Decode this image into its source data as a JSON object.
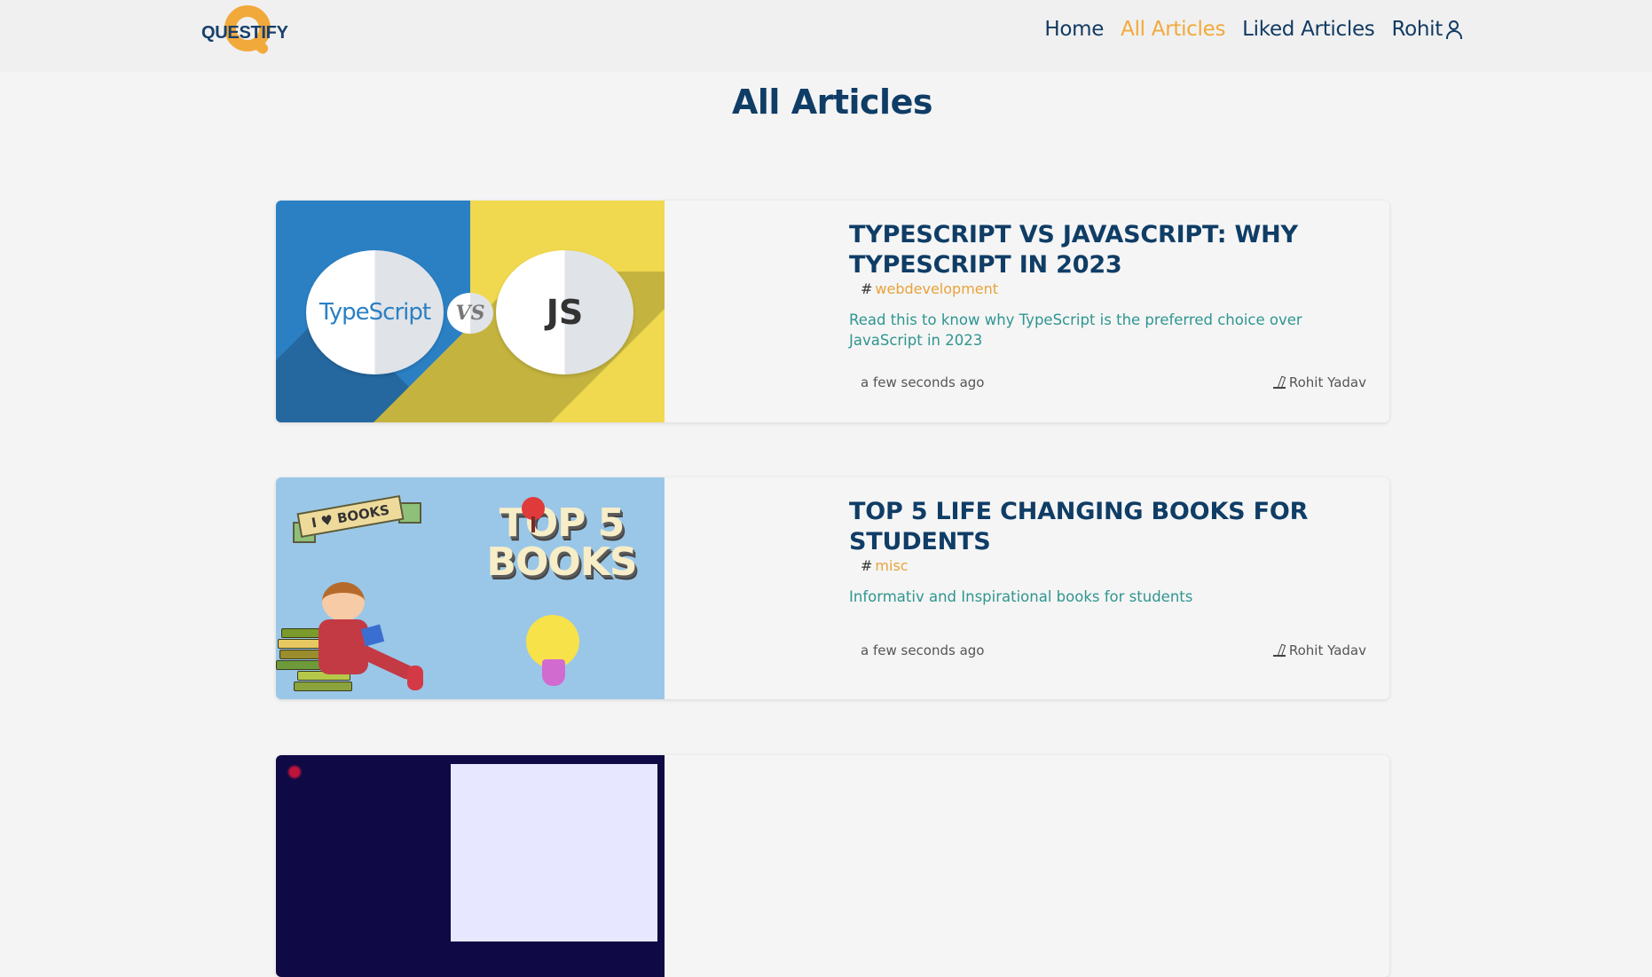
{
  "brand": {
    "name": "QUESTIFY",
    "logo_letter": "Q"
  },
  "nav": {
    "home": "Home",
    "all_articles": "All Articles",
    "liked_articles": "Liked Articles",
    "user": "Rohit"
  },
  "page": {
    "title": "All Articles"
  },
  "articles": [
    {
      "title": "TYPESCRIPT VS JAVASCRIPT: WHY TYPESCRIPT IN 2023",
      "tag": "webdevelopment",
      "description": "Read this to know why TypeScript is the preferred choice over JavaScript in 2023",
      "time": "a few seconds ago",
      "author": "Rohit Yadav",
      "thumbnail": {
        "left_text": "TypeScript",
        "middle_text": "VS",
        "right_text": "JS"
      }
    },
    {
      "title": "TOP 5 LIFE CHANGING BOOKS FOR STUDENTS",
      "tag": "misc",
      "description": "Informativ and Inspirational books for students",
      "time": "a few seconds ago",
      "author": "Rohit Yadav",
      "thumbnail": {
        "banner_text": "I ♥ BOOKS",
        "headline": "TOP 5 BOOKS"
      }
    }
  ],
  "colors": {
    "primary": "#0f3d66",
    "accent": "#f2a93b",
    "description": "#2f9590",
    "background": "#f4f4f4"
  },
  "icons": {
    "user": "user-icon",
    "author": "pen-writing-icon",
    "tag_prefix": "#"
  }
}
